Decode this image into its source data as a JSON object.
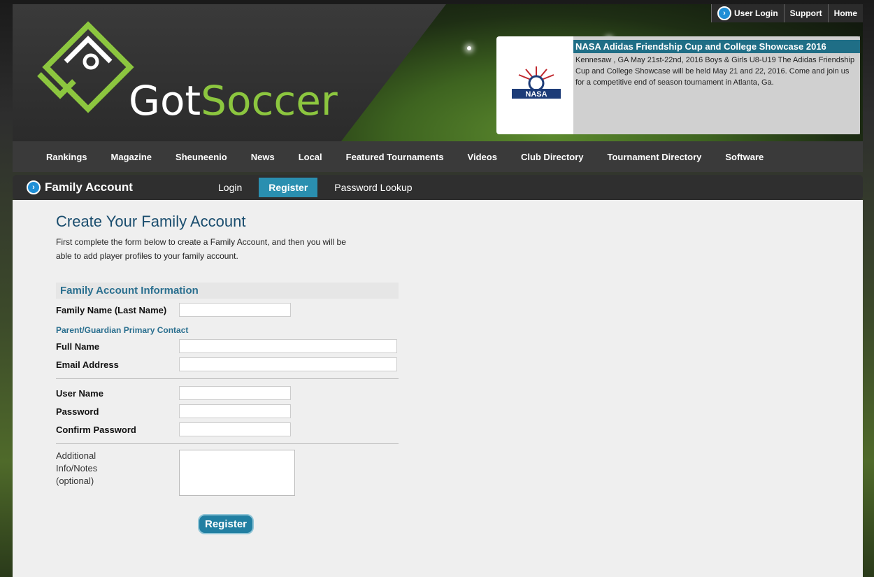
{
  "header": {
    "logo_text_main": "Got",
    "logo_text_accent": "Soccer",
    "toplinks": [
      "User Login",
      "Support",
      "Home"
    ]
  },
  "promo": {
    "title": "NASA Adidas Friendship Cup and College Showcase 2016",
    "body": "Kennesaw , GA May 21st-22nd, 2016 Boys & Girls U8-U19 The Adidas Friendship Cup and College Showcase will be held May 21 and 22, 2016. Come and join us for a competitive end of season tournament in Atlanta, Ga.",
    "logo_label": "NASA"
  },
  "mainnav": [
    "Rankings",
    "Magazine",
    "Sheuneenio",
    "News",
    "Local",
    "Featured Tournaments",
    "Videos",
    "Club Directory",
    "Tournament Directory",
    "Software"
  ],
  "subnav": {
    "title": "Family Account",
    "items": [
      "Login",
      "Register",
      "Password Lookup"
    ],
    "active": "Register"
  },
  "form": {
    "heading": "Create Your Family Account",
    "intro": "First complete the form below to create a Family Account, and then you will be able to add player profiles to your family account.",
    "section_title": "Family Account Information",
    "family_name_label": "Family Name (Last Name)",
    "contact_heading": "Parent/Guardian Primary Contact",
    "full_name_label": "Full Name",
    "email_label": "Email Address",
    "username_label": "User Name",
    "password_label": "Password",
    "confirm_label": "Confirm Password",
    "notes_line1": "Additional",
    "notes_line2": "Info/Notes",
    "notes_line3": "(optional)",
    "register_button": "Register"
  },
  "colors": {
    "accent_green": "#8cc63f",
    "link_blue": "#2a6f8f",
    "active_tab": "#2a8fb0"
  }
}
